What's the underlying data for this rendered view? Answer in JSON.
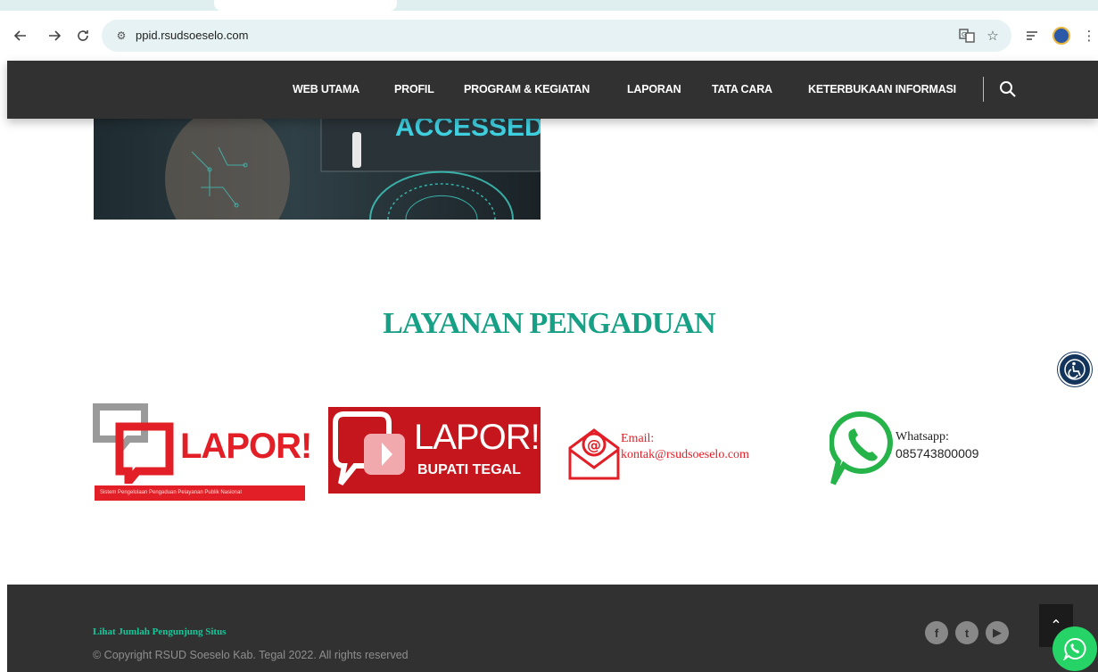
{
  "browser": {
    "url": "ppid.rsudsoeselo.com",
    "icons": [
      "back-icon",
      "forward-icon",
      "reload-icon",
      "site-settings-icon",
      "translate-icon",
      "bookmark-star-icon",
      "reading-list-icon",
      "profile-avatar",
      "more-menu-icon"
    ]
  },
  "nav": {
    "items": [
      "WEB UTAMA",
      "PROFIL",
      "PROGRAM & KEGIATAN",
      "LAPORAN",
      "TATA CARA",
      "KETERBUKAAN INFORMASI"
    ],
    "search_icon": "search-icon"
  },
  "hero": {
    "text": "ACCESSED"
  },
  "section": {
    "title": "LAYANAN PENGADUAN"
  },
  "channels": {
    "lapor": {
      "text": "LAPOR!",
      "tagline": "Sistem Pengelolaan Pengaduan Pelayanan Publik Nasional"
    },
    "lapor_bupati": {
      "text": "LAPOR!",
      "subtitle": "BUPATI TEGAL"
    },
    "email": {
      "label": "Email:",
      "value": "kontak@rsudsoeselo.com"
    },
    "whatsapp": {
      "label": "Whatsapp:",
      "value": "085743800009"
    }
  },
  "footer": {
    "counter_link": "Lihat Jumlah Pengunjung Situs",
    "copyright": "© Copyright RSUD Soeselo Kab. Tegal 2022. All rights reserved",
    "social": [
      {
        "name": "facebook-icon",
        "glyph": "f"
      },
      {
        "name": "twitter-icon",
        "glyph": "t"
      },
      {
        "name": "youtube-icon",
        "glyph": "▶"
      }
    ],
    "to_top_glyph": "⌃"
  },
  "colors": {
    "accent": "#16a085",
    "nav_bg": "#313131",
    "lapor_red": "#e21f26",
    "whatsapp_green": "#25d366",
    "a11y_blue": "#13355c"
  }
}
